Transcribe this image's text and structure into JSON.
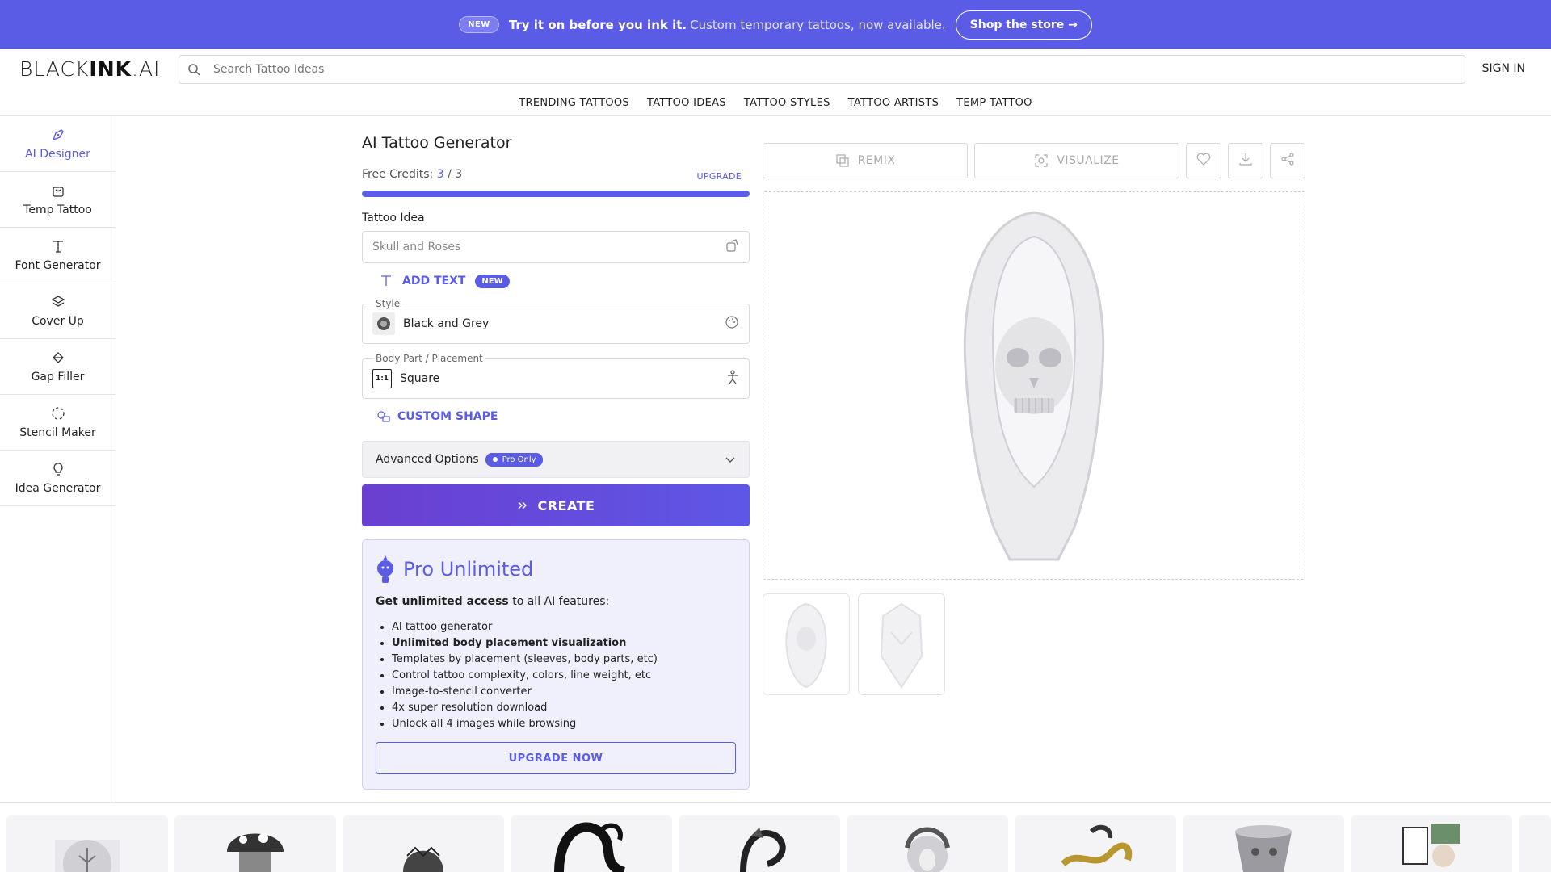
{
  "promo": {
    "badge": "NEW",
    "strong": "Try it on before you ink it.",
    "text": "Custom temporary tattoos, now available.",
    "button": "Shop the store →"
  },
  "header": {
    "logo_thin": "BLACK",
    "logo_bold": "INK",
    "logo_tail": ".AI",
    "search_placeholder": "Search Tattoo Ideas",
    "signin": "SIGN IN"
  },
  "topnav": [
    "TRENDING TATTOOS",
    "TATTOO IDEAS",
    "TATTOO STYLES",
    "TATTOO ARTISTS",
    "TEMP TATTOO"
  ],
  "sidebar": {
    "items": [
      {
        "label": "AI Designer",
        "icon": "pen-nib-icon"
      },
      {
        "label": "Temp Tattoo",
        "icon": "bag-icon"
      },
      {
        "label": "Font Generator",
        "icon": "text-icon"
      },
      {
        "label": "Cover Up",
        "icon": "layers-icon"
      },
      {
        "label": "Gap Filler",
        "icon": "paint-bucket-icon"
      },
      {
        "label": "Stencil Maker",
        "icon": "dashed-circle-icon"
      },
      {
        "label": "Idea Generator",
        "icon": "lightbulb-icon"
      }
    ]
  },
  "generator": {
    "title": "AI Tattoo Generator",
    "credits_label": "Free Credits:",
    "credits_used": "3",
    "credits_sep": " / ",
    "credits_total": "3",
    "credits_fraction": 1.0,
    "upgrade": "UPGRADE",
    "idea_label": "Tattoo Idea",
    "idea_value": "Skull and Roses",
    "add_text": "ADD TEXT",
    "add_text_badge": "NEW",
    "style_legend": "Style",
    "style_value": "Black and Grey",
    "placement_legend": "Body Part / Placement",
    "placement_value": "Square",
    "placement_thumb": "1:1",
    "custom_shape": "CUSTOM SHAPE",
    "advanced": "Advanced Options",
    "pro_only": "Pro Only",
    "create": "CREATE"
  },
  "pro": {
    "title": "Pro Unlimited",
    "sub_bold": "Get unlimited access",
    "sub_rest": " to all AI features:",
    "features": [
      "AI tattoo generator",
      "Unlimited body placement visualization",
      "Templates by placement (sleeves, body parts, etc)",
      "Control tattoo complexity, colors, line weight, etc",
      "Image-to-stencil converter",
      "4x super resolution download",
      "Unlock all 4 images while browsing"
    ],
    "button": "UPGRADE NOW"
  },
  "toolbar": {
    "remix": "REMIX",
    "visualize": "VISUALIZE"
  },
  "colors": {
    "accent": "#5b5ce6",
    "banner": "#5b5ce6"
  }
}
